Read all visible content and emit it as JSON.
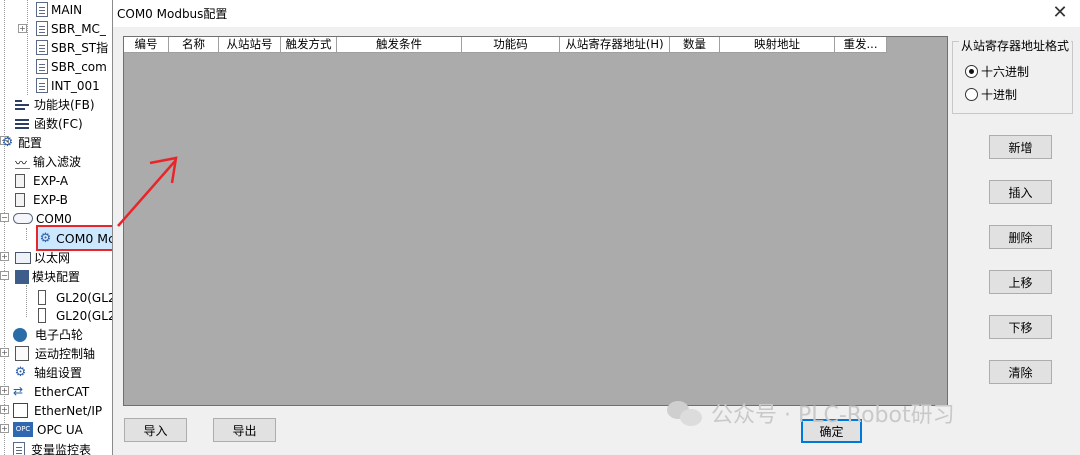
{
  "tree": {
    "items": [
      {
        "label": "MAIN"
      },
      {
        "label": "SBR_MC_"
      },
      {
        "label": "SBR_ST指"
      },
      {
        "label": "SBR_com"
      },
      {
        "label": "INT_001"
      },
      {
        "label": "功能块(FB)"
      },
      {
        "label": "函数(FC)"
      },
      {
        "label": "配置"
      },
      {
        "label": "输入滤波"
      },
      {
        "label": "EXP-A"
      },
      {
        "label": "EXP-B"
      },
      {
        "label": "COM0"
      },
      {
        "label": "COM0 Mc"
      },
      {
        "label": "以太网"
      },
      {
        "label": "模块配置"
      },
      {
        "label": "GL20(GL2"
      },
      {
        "label": "GL20(GL2"
      },
      {
        "label": "电子凸轮"
      },
      {
        "label": "运动控制轴"
      },
      {
        "label": "轴组设置"
      },
      {
        "label": "EtherCAT"
      },
      {
        "label": "EtherNet/IP"
      },
      {
        "label": "OPC UA"
      },
      {
        "label": "变量监控表"
      }
    ]
  },
  "dialog": {
    "title": "COM0 Modbus配置",
    "close_glyph": "✕",
    "columns": [
      "编号",
      "名称",
      "从站站号",
      "触发方式",
      "触发条件",
      "功能码",
      "从站寄存器地址(H)",
      "数量",
      "映射地址",
      "重发..."
    ],
    "format_group": {
      "legend": "从站寄存器地址格式",
      "options": [
        {
          "label": "十六进制",
          "checked": true
        },
        {
          "label": "十进制",
          "checked": false
        }
      ]
    },
    "buttons": {
      "add": "新增",
      "insert": "插入",
      "delete": "删除",
      "move_up": "上移",
      "move_down": "下移",
      "clear": "清除",
      "import": "导入",
      "export": "导出",
      "ok": "确定"
    }
  },
  "watermark": {
    "text": "公众号 · PLC-Robot研习"
  },
  "colors": {
    "highlight_border": "#e8262a",
    "arrow": "#e8262a",
    "grid_bg": "#ababab",
    "selection": "#cce8ff"
  }
}
